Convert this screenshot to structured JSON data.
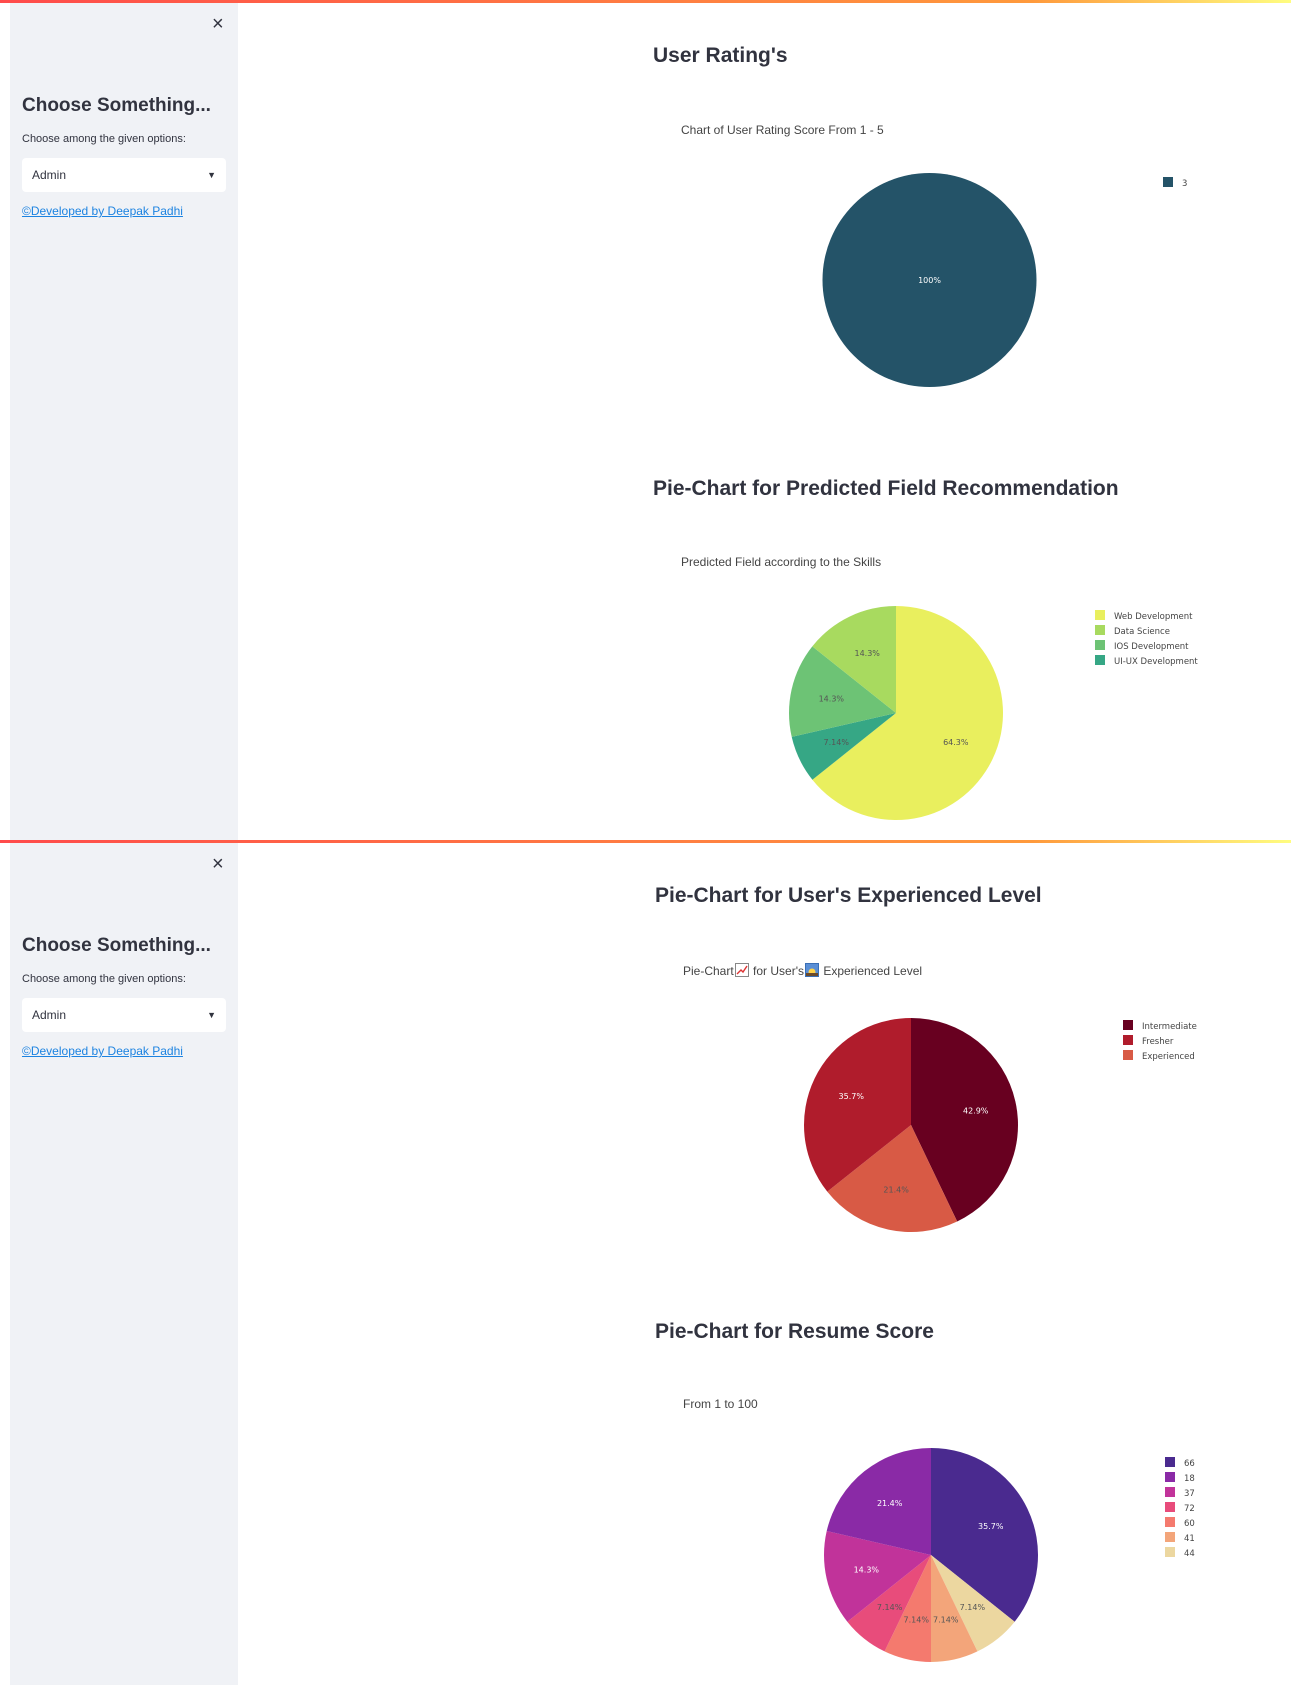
{
  "sidebar": {
    "close": "×",
    "title": "Choose Something...",
    "label": "Choose among the given options:",
    "select_value": "Admin",
    "link": "©Developed by Deepak Padhi"
  },
  "panel1": {
    "rating_title": "User Rating's",
    "rating_subtitle": "Chart of User Rating Score From 1 - 5",
    "field_title": "Pie-Chart for Predicted Field Recommendation",
    "field_subtitle": "Predicted Field according to the Skills"
  },
  "panel2": {
    "exp_title": "Pie-Chart for User's Experienced Level",
    "exp_subtitle_a": "Pie-Chart",
    "exp_subtitle_b": " for User's",
    "exp_subtitle_c": " Experienced Level",
    "score_title": "Pie-Chart for Resume Score",
    "score_subtitle": "From 1 to 100"
  },
  "chart_data": [
    {
      "id": "rating",
      "type": "pie",
      "labels": [
        "3"
      ],
      "values": [
        100
      ],
      "pct_labels": [
        "100%"
      ],
      "colors": [
        "#245368"
      ],
      "text_colors": [
        "#ffffff"
      ],
      "legend_position": "top-right"
    },
    {
      "id": "field",
      "type": "pie",
      "labels": [
        "Web Development",
        "UI-UX Development",
        "IOS Development",
        "Data Science"
      ],
      "legend_order": [
        "Web Development",
        "Data Science",
        "IOS Development",
        "UI-UX Development"
      ],
      "values": [
        64.3,
        7.14,
        14.3,
        14.3
      ],
      "pct_labels": [
        "64.3%",
        "7.14%",
        "14.3%",
        "14.3%"
      ],
      "colors": [
        "#e9ef5e",
        "#36a785",
        "#6dc375",
        "#a8da5f"
      ],
      "text_colors": [
        "#555",
        "#555",
        "#555",
        "#555"
      ],
      "legend_position": "top-right"
    },
    {
      "id": "experience",
      "type": "pie",
      "labels": [
        "Intermediate",
        "Experienced",
        "Fresher"
      ],
      "legend_order": [
        "Intermediate",
        "Fresher",
        "Experienced"
      ],
      "values": [
        42.9,
        21.4,
        35.7
      ],
      "pct_labels": [
        "42.9%",
        "21.4%",
        "35.7%"
      ],
      "colors": [
        "#680020",
        "#d85a45",
        "#b01c2c"
      ],
      "text_colors": [
        "#ffffff",
        "#555",
        "#ffffff"
      ],
      "legend_position": "top-right"
    },
    {
      "id": "score",
      "type": "pie",
      "labels": [
        "66",
        "44",
        "41",
        "60",
        "72",
        "37",
        "18"
      ],
      "legend_order": [
        "66",
        "18",
        "37",
        "72",
        "60",
        "41",
        "44"
      ],
      "values": [
        35.7,
        7.14,
        7.14,
        7.14,
        7.14,
        14.3,
        21.4
      ],
      "pct_labels": [
        "35.7%",
        "7.14%",
        "7.14%",
        "7.14%",
        "7.14%",
        "14.3%",
        "21.4%"
      ],
      "colors": [
        "#4a2a8f",
        "#ecd7a0",
        "#f3a57a",
        "#f47a6e",
        "#e84c7b",
        "#c1339a",
        "#8a2aa6"
      ],
      "text_colors": [
        "#ffffff",
        "#555",
        "#555",
        "#555",
        "#555",
        "#ffffff",
        "#ffffff"
      ],
      "legend_position": "top-right"
    }
  ]
}
